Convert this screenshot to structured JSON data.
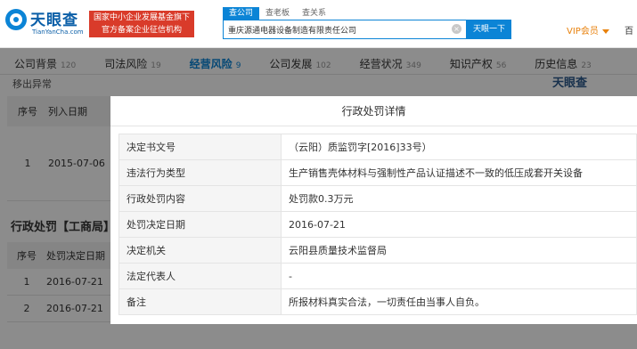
{
  "header": {
    "logo_text": "天眼查",
    "logo_sub": "TianYanCha.com",
    "badge_line1": "国家中小企业发展基金旗下",
    "badge_line2": "官方备案企业征信机构",
    "search_tabs": [
      "查公司",
      "查老板",
      "查关系"
    ],
    "search_value": "重庆源通电器设备制造有限责任公司",
    "search_button": "天眼一下",
    "vip_label": "VIP会员",
    "right_cut": "百"
  },
  "nav": [
    {
      "label": "公司背景",
      "count": "120"
    },
    {
      "label": "司法风险",
      "count": "19"
    },
    {
      "label": "经营风险",
      "count": "9",
      "active": true
    },
    {
      "label": "公司发展",
      "count": "102"
    },
    {
      "label": "经营状况",
      "count": "349"
    },
    {
      "label": "知识产权",
      "count": "56"
    },
    {
      "label": "历史信息",
      "count": "23"
    }
  ],
  "background": {
    "section_title": "移出异常",
    "watermark": "天眼查",
    "table1": {
      "headers": [
        "序号",
        "列入日期"
      ],
      "rows": [
        [
          "1",
          "2015-07-06"
        ]
      ]
    },
    "section2_title": "行政处罚【工商局】",
    "table2": {
      "headers": [
        "序号",
        "处罚决定日期"
      ],
      "rows": [
        [
          "1",
          "2016-07-21"
        ],
        [
          "2",
          "2016-07-21"
        ]
      ]
    }
  },
  "modal": {
    "title": "行政处罚详情",
    "rows": [
      {
        "label": "决定书文号",
        "value": "（云阳）质监罚字[2016]33号）"
      },
      {
        "label": "违法行为类型",
        "value": "生产销售壳体材料与强制性产品认证描述不一致的低压成套开关设备"
      },
      {
        "label": "行政处罚内容",
        "value": "处罚款0.3万元"
      },
      {
        "label": "处罚决定日期",
        "value": "2016-07-21"
      },
      {
        "label": "决定机关",
        "value": "云阳县质量技术监督局"
      },
      {
        "label": "法定代表人",
        "value": "-"
      },
      {
        "label": "备注",
        "value": "所报材料真实合法，一切责任由当事人自负。"
      }
    ]
  }
}
